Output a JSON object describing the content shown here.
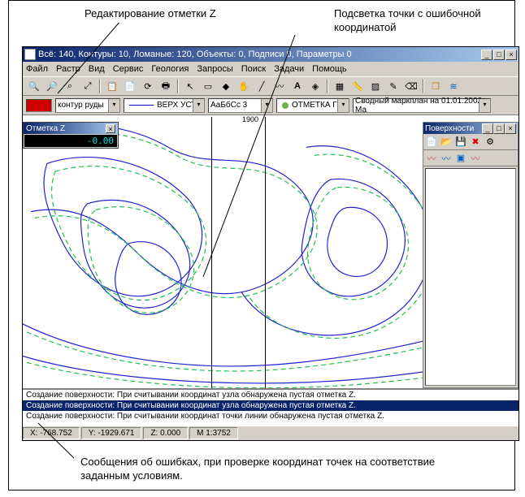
{
  "callouts": {
    "edit_z": "Редактирование отметки Z",
    "highlight_point": "Подсветка точки с ошибочной координатой",
    "error_msgs": "Сообщения об ошибках, при проверке координат точек на соответствие заданным условиям."
  },
  "window": {
    "title": "Всё: 140, Контуры: 10, Ломаные: 120, Объекты: 0, Подписи 0, Параметры 0",
    "btn_min": "_",
    "btn_max": "□",
    "btn_close": "×"
  },
  "menu": [
    "Файл",
    "Растр",
    "Вид",
    "Сервис",
    "Геология",
    "Запросы",
    "Поиск",
    "Задачи",
    "Помощь"
  ],
  "toolbar2": {
    "swatch_color": "#d00000",
    "layer": "контур руды",
    "linestyle": "ВЕРХ УСТЬ",
    "font_sample": "АаБбСс",
    "font_size": "3",
    "marker": "ОТМЕТКА Г",
    "info": "Сводный маркплан на 01.01.2002г. Ма"
  },
  "z_editor": {
    "title": "Отметка Z",
    "value": "-0.00",
    "close": "×"
  },
  "surfaces": {
    "title": "Поверхности",
    "btn_min": "_",
    "btn_max": "□",
    "btn_close": "×"
  },
  "canvas": {
    "tick": "1900"
  },
  "messages": {
    "row1": "Создание поверхности: При считывании координат узла обнаружена пустая отметка Z.",
    "row2": "Создание поверхности: При считывании координат узла обнаружена пустая отметка Z.",
    "row3": "Создание поверхности: При считывании координат точки линии обнаружена пустая отметка Z."
  },
  "status": {
    "x": "X: -768.752",
    "y": "Y: -1929.671",
    "z": "Z: 0.000",
    "scale": "М 1:3752"
  }
}
